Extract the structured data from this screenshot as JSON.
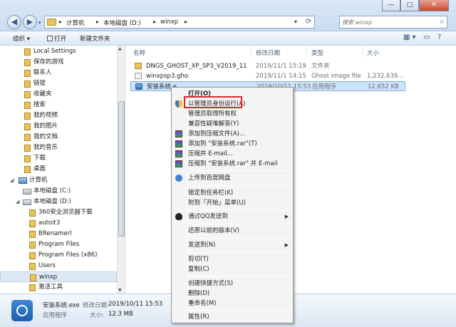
{
  "window": {
    "minimize_glyph": "—",
    "maximize_glyph": "□",
    "close_glyph": "✕"
  },
  "address": {
    "segments": [
      "计算机",
      "本地磁盘 (D:)",
      "winxp"
    ],
    "separator": "▸",
    "back_glyph": "◀",
    "forward_glyph": "▶",
    "dropdown_glyph": "▾",
    "refresh_glyph": "⟳"
  },
  "search": {
    "placeholder": "搜索 winxp",
    "icon": "search-icon"
  },
  "toolbar": {
    "organize": "组织 ▾",
    "open": "打开",
    "new_folder": "新建文件夹",
    "view_glyph": "▦ ▾",
    "pane_glyph": "▭",
    "help_glyph": "?"
  },
  "nav": {
    "items": [
      "Local Settings",
      "保存的游戏",
      "联系人",
      "链接",
      "收藏夹",
      "搜索",
      "我的视频",
      "我的图片",
      "我的文档",
      "我的音乐",
      "下载",
      "桌面",
      "计算机",
      "本地磁盘 (C:)",
      "本地磁盘 (D:)",
      "360安全浏览器下载",
      "autoit3",
      "BRenamerl",
      "Program Files",
      "Program Files (x86)",
      "Users",
      "winxp",
      "激活工具"
    ],
    "selected": "winxp",
    "expand_glyph": "◢",
    "scroll_up": "▲",
    "scroll_down": "▼"
  },
  "columns": [
    "名称",
    "修改日期",
    "类型",
    "大小"
  ],
  "files": [
    {
      "name": "DNGS_GHOST_XP_SP3_V2019_11",
      "date": "2019/11/1 15:19",
      "type": "文件夹",
      "size": ""
    },
    {
      "name": "winxpsp3.gho",
      "date": "2019/11/1 14:15",
      "type": "Ghost image file",
      "size": "1,232,639..."
    },
    {
      "name": "安装系统.e",
      "date": "2019/10/11 15:53",
      "type": "应用程序",
      "size": "12,652 KB"
    }
  ],
  "details": {
    "name": "安装系统.exe",
    "modified_label": "修改日期:",
    "modified": "2019/10/11 15:53",
    "type": "应用程序",
    "size_label": "大小:",
    "size": "12.3 MB"
  },
  "menu": {
    "open": "打开(O)",
    "run_as_admin": "以管理员身份运行(A)",
    "take_ownership": "管理员取得所有权",
    "compat": "兼容性疑难解答(Y)",
    "add_archive": "添加到压缩文件(A)...",
    "add_rar": "添加到 \"安装系统.rar\"(T)",
    "compress_email": "压缩并 E-mail...",
    "compress_rar_email": "压缩到 \"安装系统.rar\" 并 E-mail",
    "baidu": "上传到百度网盘",
    "pin_taskbar": "锁定到任务栏(K)",
    "pin_start": "附到「开始」菜单(U)",
    "qq_send": "通过QQ发送到",
    "restore": "还原以前的版本(V)",
    "send_to": "发送到(N)",
    "cut": "剪切(T)",
    "copy": "复制(C)",
    "shortcut": "创建快捷方式(S)",
    "delete": "删除(D)",
    "rename": "重命名(M)",
    "properties": "属性(R)",
    "submenu_glyph": "▶"
  }
}
